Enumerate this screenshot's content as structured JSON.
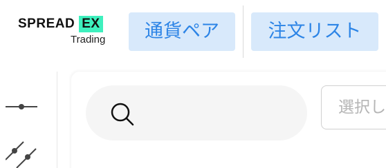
{
  "logo": {
    "brand": "SPREAD",
    "badge": "EX",
    "sub": "Trading"
  },
  "nav": {
    "pair_label": "通貨ペア",
    "order_list_label": "注文リスト"
  },
  "toolbar": {
    "icons": [
      "horizontal-line-icon",
      "trend-line-icon"
    ]
  },
  "search": {
    "placeholder": "",
    "value": ""
  },
  "select": {
    "label": "選択し"
  },
  "colors": {
    "accent_bg": "#d8e9fb",
    "accent_text": "#2c84e6",
    "logo_badge": "#3ef0be",
    "search_bg": "#f5f5f5",
    "placeholder_text": "#b5b5b5"
  }
}
